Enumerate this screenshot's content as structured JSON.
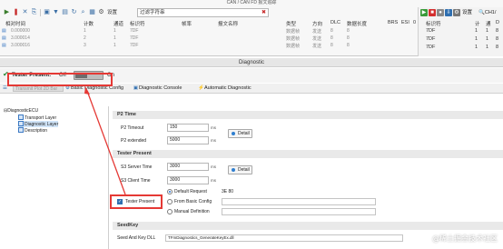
{
  "can_window": {
    "title": "CAN / CAN FD 报文追踪",
    "settings_label": "设置",
    "filter_placeholder": "过滤字符串",
    "columns": [
      "相对时间",
      "计数",
      "通道",
      "标识符",
      "帧率",
      "报文名称",
      "类型",
      "方向",
      "DLC",
      "数据长度",
      "BRS",
      "ESI",
      "0"
    ],
    "rows": [
      {
        "time": "0.000000",
        "count": "1",
        "channel": "1",
        "id": "7DF",
        "type": "数据帧",
        "dir": "发送",
        "dlc": "8",
        "len": "8"
      },
      {
        "time": "3.000014",
        "count": "2",
        "channel": "1",
        "id": "7DF",
        "type": "数据帧",
        "dir": "发送",
        "dlc": "8",
        "len": "8"
      },
      {
        "time": "3.000016",
        "count": "3",
        "channel": "1",
        "id": "7DF",
        "type": "数据帧",
        "dir": "发送",
        "dlc": "8",
        "len": "8"
      }
    ]
  },
  "right_panel": {
    "settings_label": "设置",
    "channel_label": "CH1/",
    "columns": [
      "标识符",
      "计",
      "通",
      "D"
    ],
    "rows": [
      {
        "id": "7DF",
        "c": "1",
        "ch": "1",
        "d": "8"
      },
      {
        "id": "7DF",
        "c": "1",
        "ch": "1",
        "d": "8"
      },
      {
        "id": "7DF",
        "c": "1",
        "ch": "1",
        "d": "8"
      }
    ]
  },
  "diagnostic": {
    "title": "Diagnostic",
    "tester_present_label": "Tester Present:",
    "off_label": "Off",
    "on_label": "On",
    "toggle_state": "off",
    "tabs": [
      "Basic Diagnostic Config",
      "Diagnostic Console",
      "Automatic Diagnostic"
    ],
    "tab_overlay_text": "Transmit Plot 2D Bar",
    "tree": {
      "root": "DiagnosticECU",
      "children": [
        "Transport Layer",
        "Diagnostic Layer",
        "Description"
      ],
      "selected": "Diagnostic Layer"
    },
    "p2": {
      "header": "P2 Time",
      "timeout_label": "P2 Timeout",
      "timeout_value": "150",
      "extended_label": "P2 extended",
      "extended_value": "5000",
      "unit": "ms",
      "detail_label": "Detail"
    },
    "tester_present": {
      "header": "Tester Present",
      "s3_server_label": "S3 Server Time",
      "s3_server_value": "3000",
      "s3_client_label": "S3 Client Time",
      "s3_client_value": "3000",
      "unit": "ms",
      "detail_label": "Detail",
      "checkbox_label": "Tester Present",
      "checked": true,
      "options": [
        "Default Request",
        "From Basic Config",
        "Manual Definition"
      ],
      "selected_option": "Default Request",
      "request_value": "3E 80"
    },
    "seed_key": {
      "header": "SeedKey",
      "dll_label": "Seed And Key DLL",
      "dll_value": "TFmDiagnostics_GenerateKeyEx.dll"
    }
  },
  "watermark": "@稀土掘金技术社区",
  "colors": {
    "highlight_red": "#e53935",
    "accent_blue": "#2f6fb0",
    "section_gray": "#e9e9e9"
  }
}
